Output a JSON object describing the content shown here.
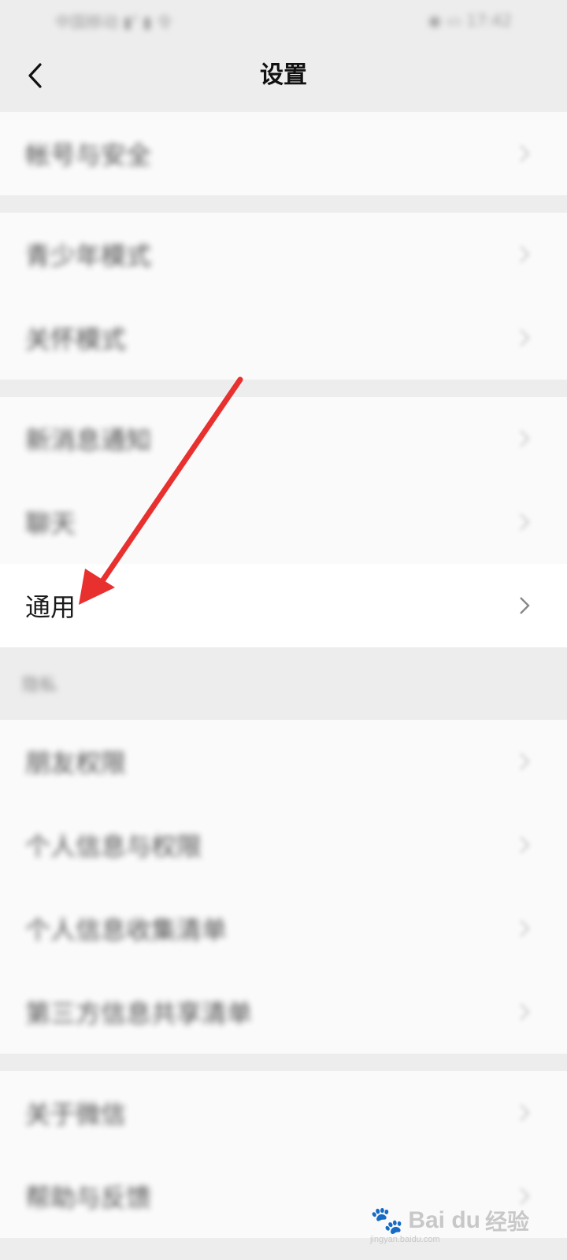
{
  "status_bar": {
    "left": "中国移动 ▮ᵀ ▮ 令",
    "right": "◉ ▭ 17:42"
  },
  "header": {
    "title": "设置"
  },
  "groups": [
    {
      "items": [
        {
          "label": "帐号与安全"
        }
      ]
    },
    {
      "items": [
        {
          "label": "青少年模式"
        },
        {
          "label": "关怀模式"
        }
      ]
    },
    {
      "items": [
        {
          "label": "新消息通知"
        },
        {
          "label": "聊天"
        },
        {
          "label": "通用"
        }
      ]
    }
  ],
  "privacy_section": {
    "header": "隐私",
    "items": [
      {
        "label": "朋友权限"
      },
      {
        "label": "个人信息与权限"
      },
      {
        "label": "个人信息收集清单"
      },
      {
        "label": "第三方信息共享清单"
      }
    ]
  },
  "about_group": {
    "items": [
      {
        "label": "关于微信"
      },
      {
        "label": "帮助与反馈"
      }
    ]
  },
  "annotation": {
    "color": "#e8312f",
    "target": "通用"
  },
  "watermark": {
    "brand": "Bai du",
    "cn": "经验",
    "sub": "jingyan.baidu.com"
  }
}
